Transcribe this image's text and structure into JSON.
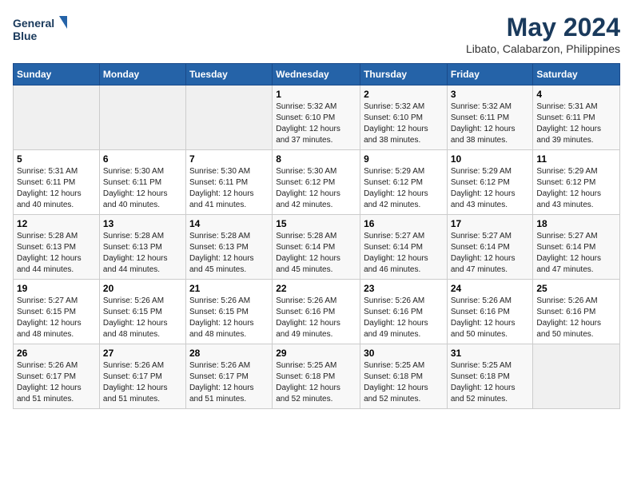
{
  "header": {
    "logo_line1": "General",
    "logo_line2": "Blue",
    "month_year": "May 2024",
    "location": "Libato, Calabarzon, Philippines"
  },
  "days_of_week": [
    "Sunday",
    "Monday",
    "Tuesday",
    "Wednesday",
    "Thursday",
    "Friday",
    "Saturday"
  ],
  "weeks": [
    [
      {
        "day": "",
        "info": ""
      },
      {
        "day": "",
        "info": ""
      },
      {
        "day": "",
        "info": ""
      },
      {
        "day": "1",
        "info": "Sunrise: 5:32 AM\nSunset: 6:10 PM\nDaylight: 12 hours\nand 37 minutes."
      },
      {
        "day": "2",
        "info": "Sunrise: 5:32 AM\nSunset: 6:10 PM\nDaylight: 12 hours\nand 38 minutes."
      },
      {
        "day": "3",
        "info": "Sunrise: 5:32 AM\nSunset: 6:11 PM\nDaylight: 12 hours\nand 38 minutes."
      },
      {
        "day": "4",
        "info": "Sunrise: 5:31 AM\nSunset: 6:11 PM\nDaylight: 12 hours\nand 39 minutes."
      }
    ],
    [
      {
        "day": "5",
        "info": "Sunrise: 5:31 AM\nSunset: 6:11 PM\nDaylight: 12 hours\nand 40 minutes."
      },
      {
        "day": "6",
        "info": "Sunrise: 5:30 AM\nSunset: 6:11 PM\nDaylight: 12 hours\nand 40 minutes."
      },
      {
        "day": "7",
        "info": "Sunrise: 5:30 AM\nSunset: 6:11 PM\nDaylight: 12 hours\nand 41 minutes."
      },
      {
        "day": "8",
        "info": "Sunrise: 5:30 AM\nSunset: 6:12 PM\nDaylight: 12 hours\nand 42 minutes."
      },
      {
        "day": "9",
        "info": "Sunrise: 5:29 AM\nSunset: 6:12 PM\nDaylight: 12 hours\nand 42 minutes."
      },
      {
        "day": "10",
        "info": "Sunrise: 5:29 AM\nSunset: 6:12 PM\nDaylight: 12 hours\nand 43 minutes."
      },
      {
        "day": "11",
        "info": "Sunrise: 5:29 AM\nSunset: 6:12 PM\nDaylight: 12 hours\nand 43 minutes."
      }
    ],
    [
      {
        "day": "12",
        "info": "Sunrise: 5:28 AM\nSunset: 6:13 PM\nDaylight: 12 hours\nand 44 minutes."
      },
      {
        "day": "13",
        "info": "Sunrise: 5:28 AM\nSunset: 6:13 PM\nDaylight: 12 hours\nand 44 minutes."
      },
      {
        "day": "14",
        "info": "Sunrise: 5:28 AM\nSunset: 6:13 PM\nDaylight: 12 hours\nand 45 minutes."
      },
      {
        "day": "15",
        "info": "Sunrise: 5:28 AM\nSunset: 6:14 PM\nDaylight: 12 hours\nand 45 minutes."
      },
      {
        "day": "16",
        "info": "Sunrise: 5:27 AM\nSunset: 6:14 PM\nDaylight: 12 hours\nand 46 minutes."
      },
      {
        "day": "17",
        "info": "Sunrise: 5:27 AM\nSunset: 6:14 PM\nDaylight: 12 hours\nand 47 minutes."
      },
      {
        "day": "18",
        "info": "Sunrise: 5:27 AM\nSunset: 6:14 PM\nDaylight: 12 hours\nand 47 minutes."
      }
    ],
    [
      {
        "day": "19",
        "info": "Sunrise: 5:27 AM\nSunset: 6:15 PM\nDaylight: 12 hours\nand 48 minutes."
      },
      {
        "day": "20",
        "info": "Sunrise: 5:26 AM\nSunset: 6:15 PM\nDaylight: 12 hours\nand 48 minutes."
      },
      {
        "day": "21",
        "info": "Sunrise: 5:26 AM\nSunset: 6:15 PM\nDaylight: 12 hours\nand 48 minutes."
      },
      {
        "day": "22",
        "info": "Sunrise: 5:26 AM\nSunset: 6:16 PM\nDaylight: 12 hours\nand 49 minutes."
      },
      {
        "day": "23",
        "info": "Sunrise: 5:26 AM\nSunset: 6:16 PM\nDaylight: 12 hours\nand 49 minutes."
      },
      {
        "day": "24",
        "info": "Sunrise: 5:26 AM\nSunset: 6:16 PM\nDaylight: 12 hours\nand 50 minutes."
      },
      {
        "day": "25",
        "info": "Sunrise: 5:26 AM\nSunset: 6:16 PM\nDaylight: 12 hours\nand 50 minutes."
      }
    ],
    [
      {
        "day": "26",
        "info": "Sunrise: 5:26 AM\nSunset: 6:17 PM\nDaylight: 12 hours\nand 51 minutes."
      },
      {
        "day": "27",
        "info": "Sunrise: 5:26 AM\nSunset: 6:17 PM\nDaylight: 12 hours\nand 51 minutes."
      },
      {
        "day": "28",
        "info": "Sunrise: 5:26 AM\nSunset: 6:17 PM\nDaylight: 12 hours\nand 51 minutes."
      },
      {
        "day": "29",
        "info": "Sunrise: 5:25 AM\nSunset: 6:18 PM\nDaylight: 12 hours\nand 52 minutes."
      },
      {
        "day": "30",
        "info": "Sunrise: 5:25 AM\nSunset: 6:18 PM\nDaylight: 12 hours\nand 52 minutes."
      },
      {
        "day": "31",
        "info": "Sunrise: 5:25 AM\nSunset: 6:18 PM\nDaylight: 12 hours\nand 52 minutes."
      },
      {
        "day": "",
        "info": ""
      }
    ]
  ]
}
